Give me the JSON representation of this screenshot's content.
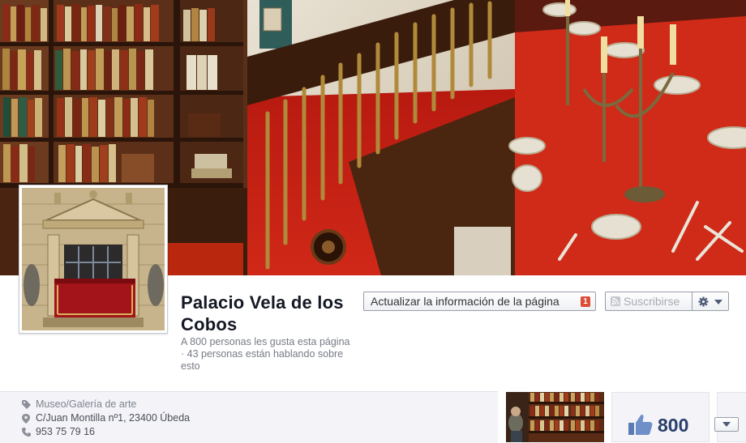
{
  "page": {
    "name": "Palacio Vela de los Cobos",
    "likes_summary": "A 800 personas les gusta esta página · 43 personas están hablando sobre esto"
  },
  "actions": {
    "update_label": "Actualizar la información de la página",
    "update_badge": "1",
    "subscribe_label": "Suscribirse"
  },
  "about": {
    "category": "Museo/Galería de arte",
    "address": "C/Juan Montilla nº1, 23400 Úbeda",
    "phone": "953 75 79 16"
  },
  "likes_box": {
    "count": "800"
  },
  "icons": {
    "category": "tag-icon",
    "address": "map-pin-icon",
    "phone": "phone-icon",
    "likes": "thumbs-up-icon",
    "settings": "gear-icon",
    "subscribe": "rss-icon"
  },
  "colors": {
    "title": "#141823",
    "badge": "#dd4b39",
    "like_count": "#2a3f6c",
    "info_bg": "#f3f3f8"
  }
}
